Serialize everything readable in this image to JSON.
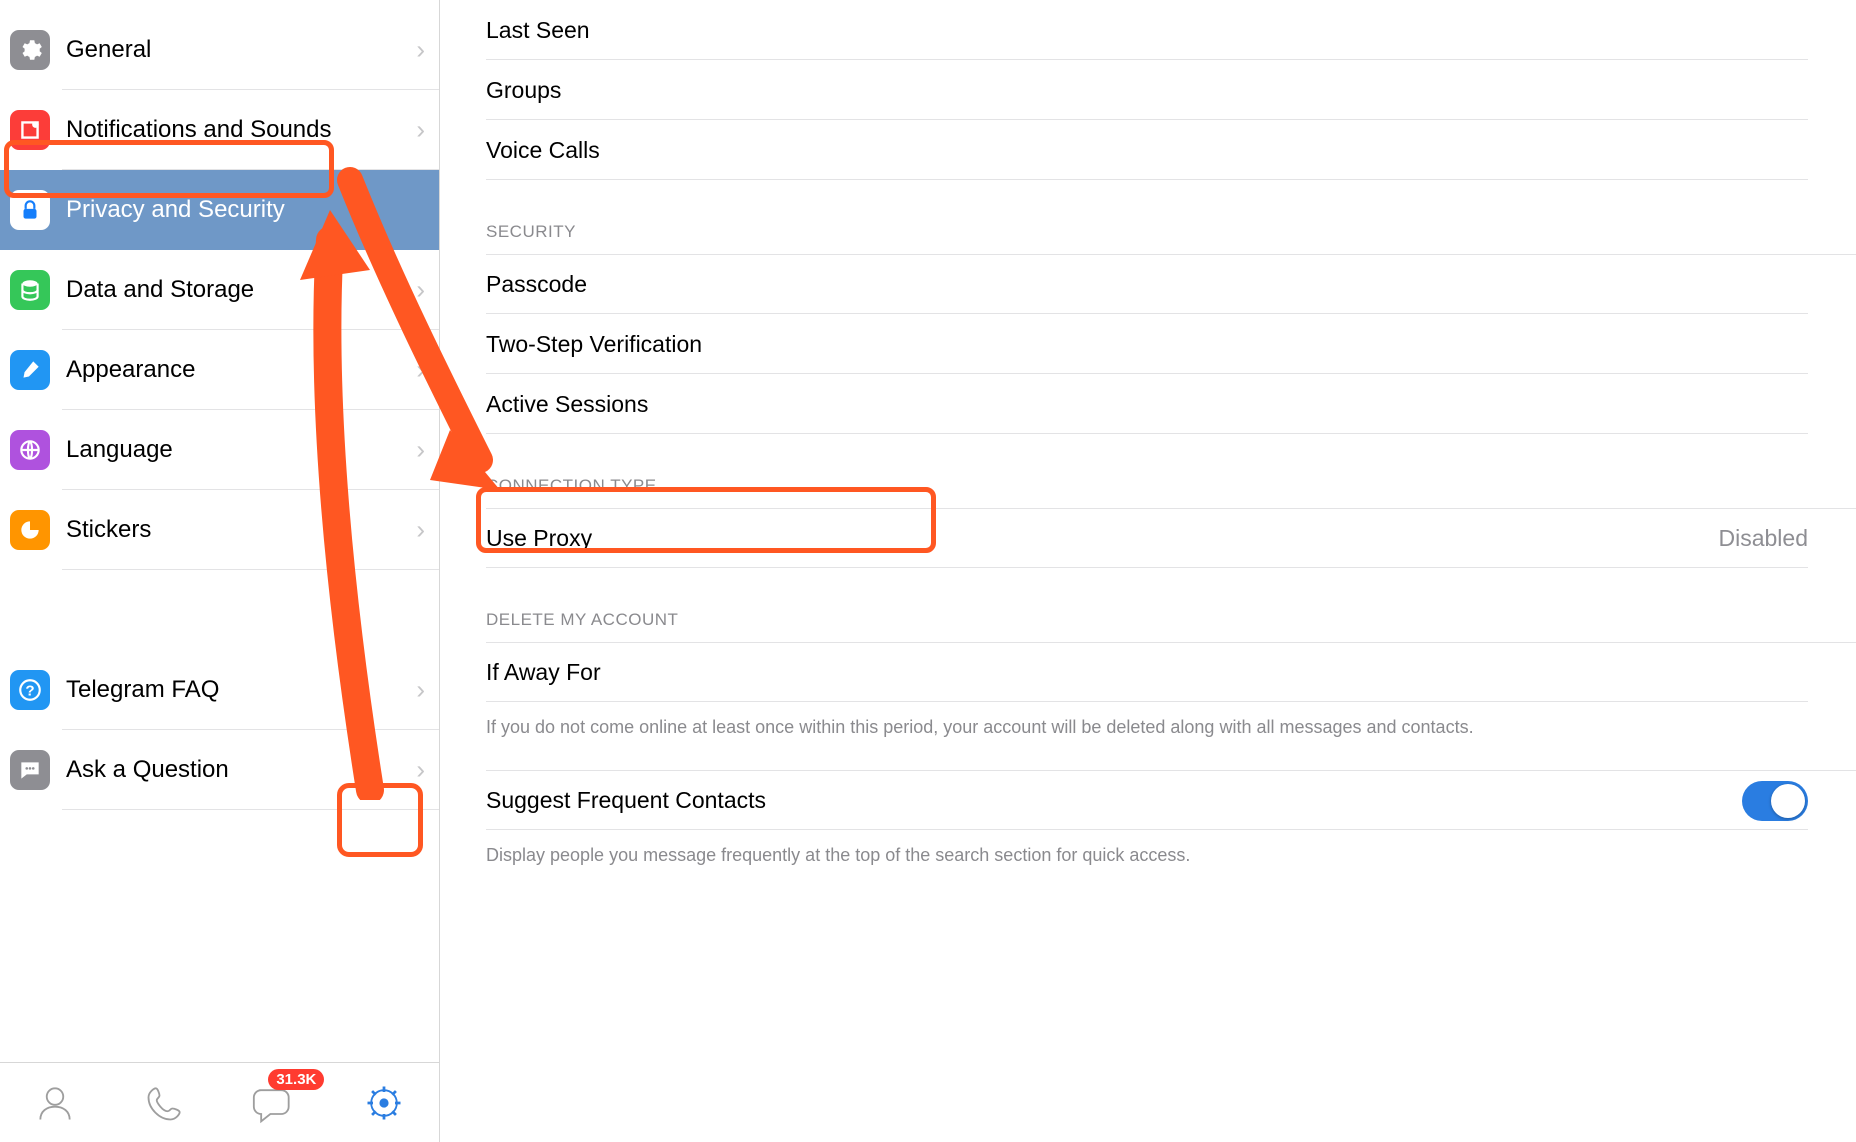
{
  "sidebar": {
    "items": [
      {
        "id": "general",
        "label": "General",
        "icon": "gear",
        "color": "ic-gray",
        "selected": false
      },
      {
        "id": "notif",
        "label": "Notifications and Sounds",
        "icon": "bell",
        "color": "ic-red",
        "selected": false
      },
      {
        "id": "privacy",
        "label": "Privacy and Security",
        "icon": "lock",
        "color": "ic-white",
        "selected": true
      },
      {
        "id": "data",
        "label": "Data and Storage",
        "icon": "db",
        "color": "ic-green",
        "selected": false
      },
      {
        "id": "appear",
        "label": "Appearance",
        "icon": "brush",
        "color": "ic-sky",
        "selected": false
      },
      {
        "id": "lang",
        "label": "Language",
        "icon": "globe",
        "color": "ic-purple",
        "selected": false
      },
      {
        "id": "stickers",
        "label": "Stickers",
        "icon": "sticker",
        "color": "ic-orange",
        "selected": false
      }
    ],
    "help_items": [
      {
        "id": "faq",
        "label": "Telegram FAQ",
        "icon": "question",
        "color": "ic-teal"
      },
      {
        "id": "ask",
        "label": "Ask a Question",
        "icon": "chat",
        "color": "ic-gray2"
      }
    ]
  },
  "tabbar": {
    "badge": "31.3K"
  },
  "content": {
    "privacy_rows": [
      {
        "label": "Last Seen"
      },
      {
        "label": "Groups"
      },
      {
        "label": "Voice Calls"
      }
    ],
    "security_header": "SECURITY",
    "security_rows": [
      {
        "label": "Passcode"
      },
      {
        "label": "Two-Step Verification"
      },
      {
        "label": "Active Sessions"
      }
    ],
    "connection_header": "CONNECTION TYPE",
    "proxy": {
      "label": "Use Proxy",
      "value": "Disabled"
    },
    "delete_header": "DELETE MY ACCOUNT",
    "delete_row": {
      "label": "If Away For"
    },
    "delete_hint": "If you do not come online at least once within this period, your account will be deleted along with all messages and contacts.",
    "suggest_row": {
      "label": "Suggest Frequent Contacts"
    },
    "suggest_hint": "Display people you message frequently at the top of the search section for quick access."
  },
  "annotations": {
    "highlight_sidebar": true,
    "highlight_proxy": true,
    "highlight_settings_tab": true
  }
}
